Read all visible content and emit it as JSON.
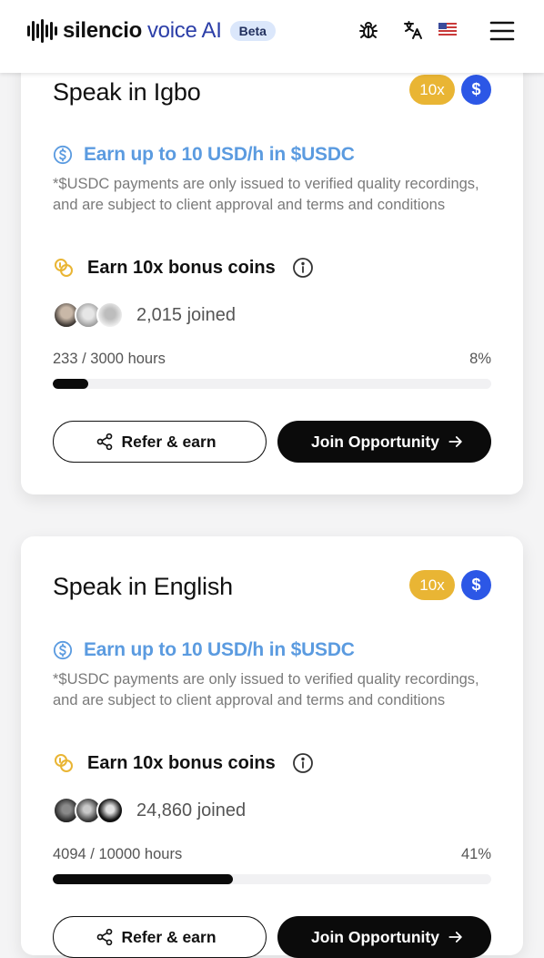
{
  "header": {
    "brand_bold": "silencio",
    "brand_light": "voice AI",
    "beta": "Beta",
    "icons": [
      "bug-icon",
      "translate-icon",
      "us-flag-icon",
      "menu-icon"
    ]
  },
  "colors": {
    "gold": "#e9b534",
    "usd_blue": "#2c57e6",
    "earn_blue": "#5b9be0",
    "progress": "#0b0b0b"
  },
  "cards": [
    {
      "title": "Speak in Igbo",
      "multiplier_badge": "10x",
      "currency_badge": "$",
      "earn_text": "Earn up to 10 USD/h in $USDC",
      "disclaimer": "*$USDC payments are only issued to verified quality recordings, and are subject to client approval and terms and conditions",
      "bonus_text": "Earn 10x bonus coins",
      "joined_text": "2,015 joined",
      "hours_text": "233 / 3000 hours",
      "percent_text": "8%",
      "progress": 0.08,
      "refer_label": "Refer & earn",
      "join_label": "Join Opportunity"
    },
    {
      "title": "Speak in English",
      "multiplier_badge": "10x",
      "currency_badge": "$",
      "earn_text": "Earn up to 10 USD/h in $USDC",
      "disclaimer": "*$USDC payments are only issued to verified quality recordings, and are subject to client approval and terms and conditions",
      "bonus_text": "Earn 10x bonus coins",
      "joined_text": "24,860 joined",
      "hours_text": "4094 / 10000 hours",
      "percent_text": "41%",
      "progress": 0.41,
      "refer_label": "Refer & earn",
      "join_label": "Join Opportunity"
    }
  ]
}
